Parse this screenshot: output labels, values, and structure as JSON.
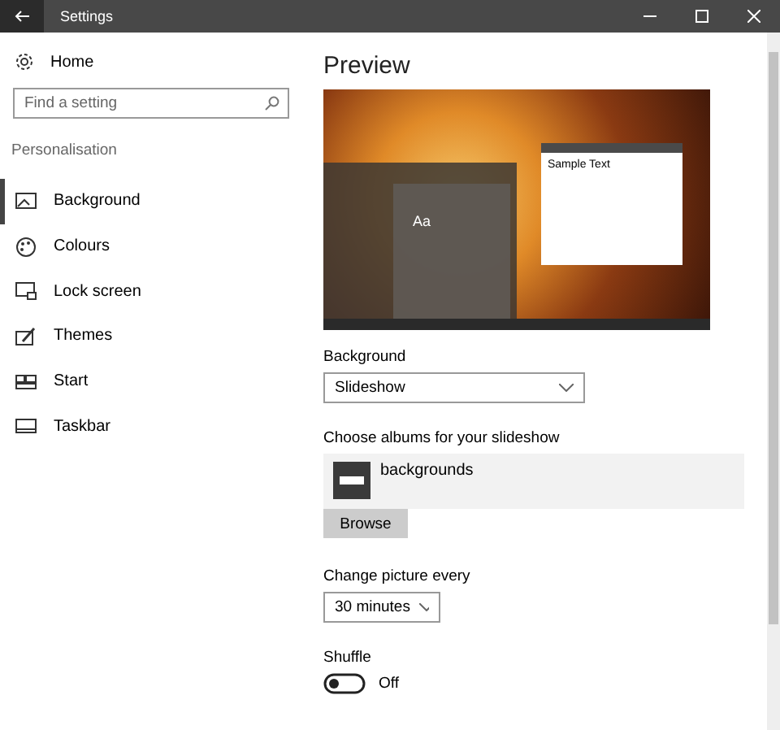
{
  "window": {
    "title": "Settings"
  },
  "sidebar": {
    "home": "Home",
    "search": {
      "placeholder": "Find a setting"
    },
    "section": "Personalisation",
    "items": [
      {
        "label": "Background",
        "selected": true
      },
      {
        "label": "Colours",
        "selected": false
      },
      {
        "label": "Lock screen",
        "selected": false
      },
      {
        "label": "Themes",
        "selected": false
      },
      {
        "label": "Start",
        "selected": false
      },
      {
        "label": "Taskbar",
        "selected": false
      }
    ]
  },
  "content": {
    "heading": "Preview",
    "preview": {
      "tile_text": "Aa",
      "sample_text": "Sample Text"
    },
    "background": {
      "label": "Background",
      "value": "Slideshow"
    },
    "albums": {
      "label": "Choose albums for your slideshow",
      "items": [
        "backgrounds"
      ],
      "button": "Browse"
    },
    "interval": {
      "label": "Change picture every",
      "value": "30 minutes"
    },
    "shuffle": {
      "label": "Shuffle",
      "on": false,
      "state_text": "Off"
    }
  }
}
